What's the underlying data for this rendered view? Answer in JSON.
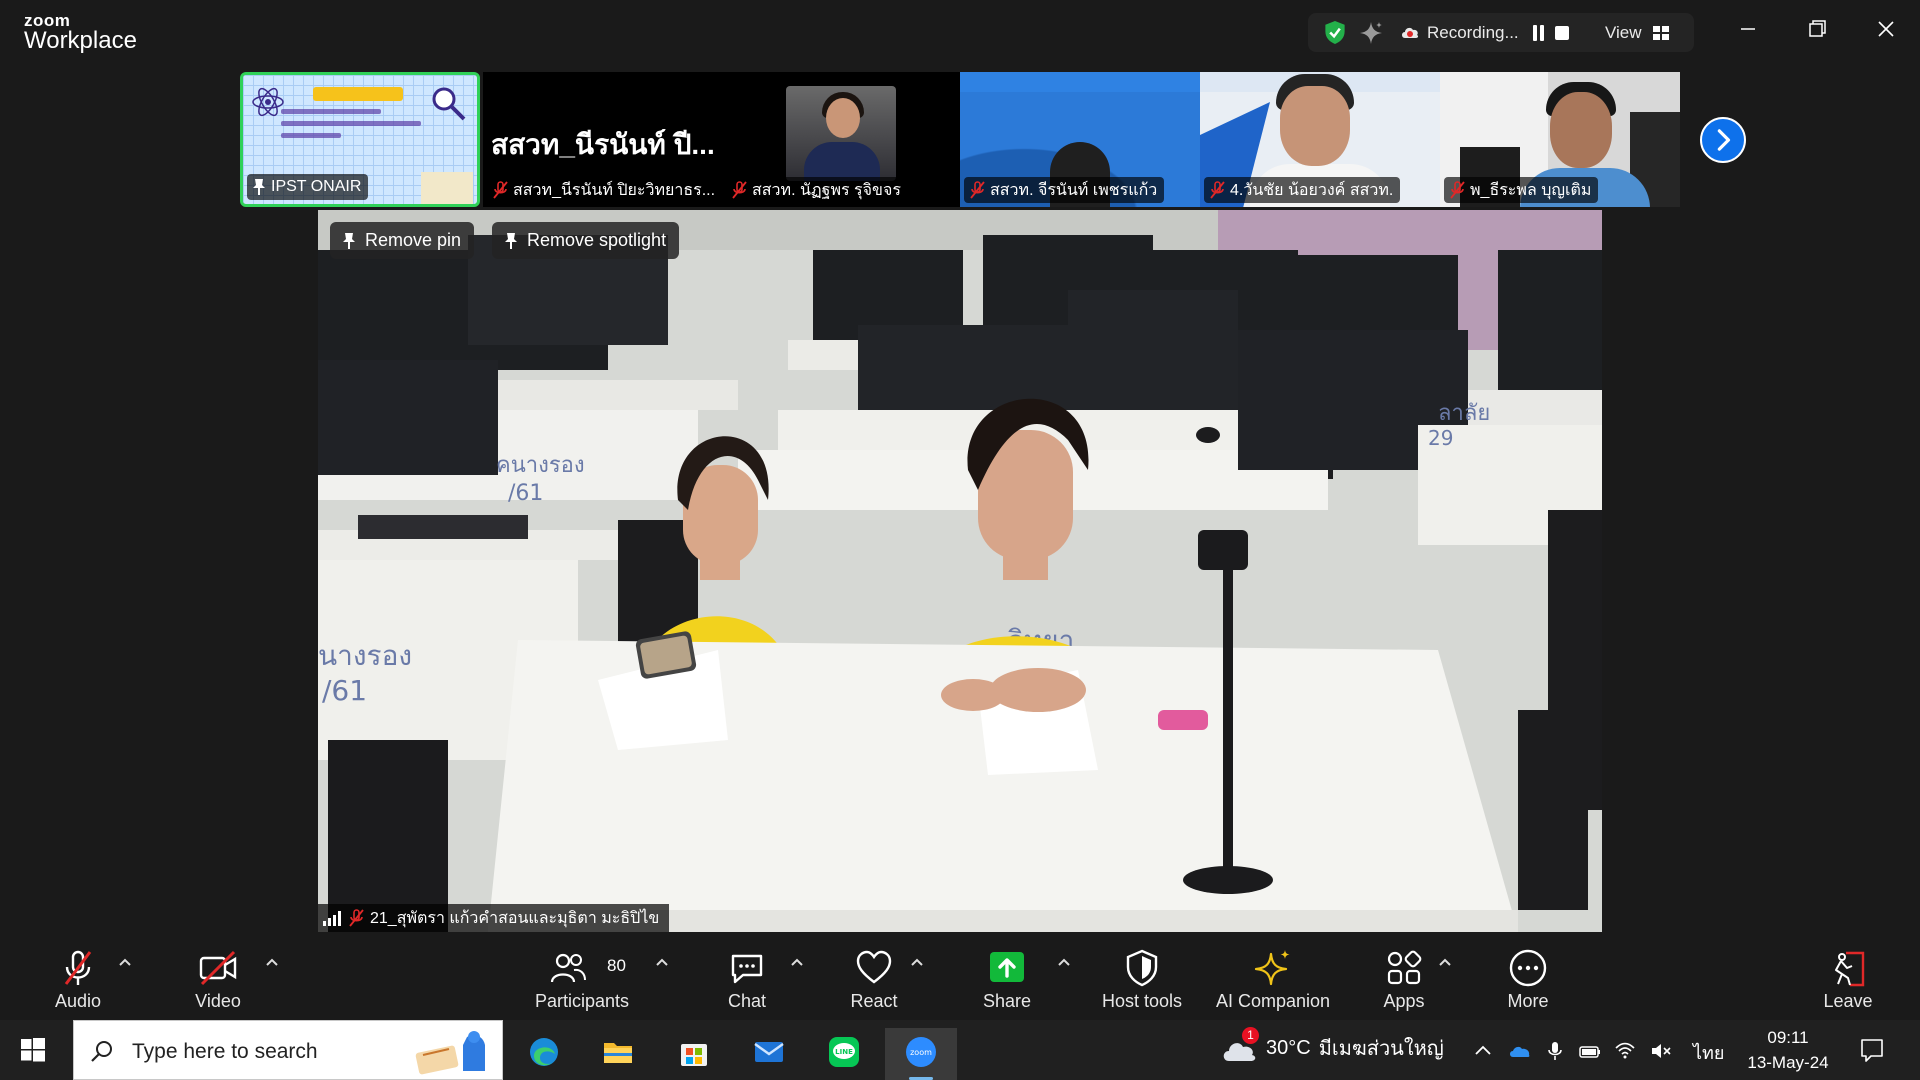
{
  "titlebar": {
    "brand_top": "zoom",
    "brand_bottom": "Workplace",
    "recording_label": "Recording...",
    "view_label": "View"
  },
  "thumbnails": [
    {
      "name": "IPST ONAIR",
      "pinned": true
    },
    {
      "big_name": "สสวท_นีรนันท์ ปี...",
      "name": "สสวท_นีรนันท์ ปิยะวิทยาธร...",
      "mic": "muted"
    },
    {
      "name": "สสวท. นัฏฐพร รุจิขจร",
      "mic": "muted"
    },
    {
      "name": "สสวท. จีรนันท์ เพชรแก้ว",
      "mic": "muted"
    },
    {
      "name": "4.วันชัย น้อยวงค์ สสวท.",
      "mic": "muted"
    },
    {
      "name": "พ_ธีระพล บุญเติม",
      "mic": "muted"
    }
  ],
  "main_video": {
    "remove_pin_label": "Remove pin",
    "remove_spotlight_label": "Remove spotlight",
    "speaker_name": "21_สุพัตรา แก้วคำสอนและมุธิตา มะธิปิไข",
    "wall_texts": [
      "คนางรอง",
      "/61",
      "นางรอง",
      "/61",
      "วิทยา",
      "ลาลัย",
      "29"
    ]
  },
  "toolbar": {
    "audio": "Audio",
    "video": "Video",
    "participants": "Participants",
    "participants_count": "80",
    "chat": "Chat",
    "react": "React",
    "share": "Share",
    "host_tools": "Host tools",
    "ai_companion": "AI Companion",
    "apps": "Apps",
    "more": "More",
    "leave": "Leave"
  },
  "taskbar": {
    "search_placeholder": "Type here to search",
    "weather_temp": "30°C",
    "weather_desc": "มีเมฆส่วนใหญ่",
    "weather_badge": "1",
    "language": "ไทย",
    "time": "09:11",
    "date": "13-May-24"
  },
  "colors": {
    "accent_blue": "#0e71eb",
    "share_green": "#12b93a",
    "active_speaker_border": "#30d158",
    "muted_red": "#e02828",
    "shirt_yellow": "#f2d21e"
  }
}
